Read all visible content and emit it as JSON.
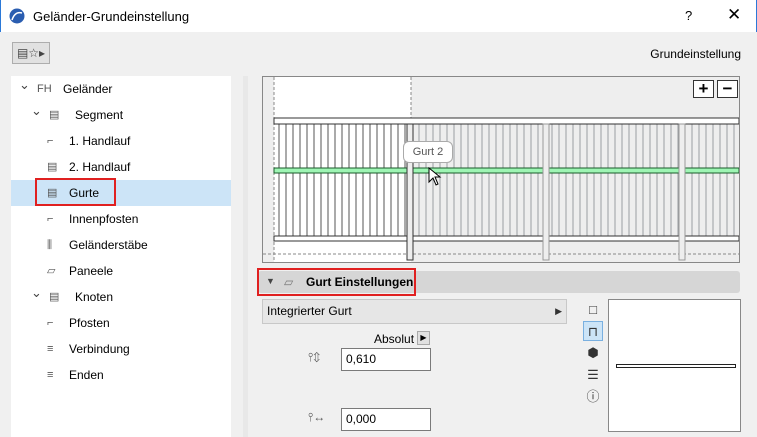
{
  "window": {
    "title": "Geländer-Grundeinstellung",
    "help": "?",
    "close": "✕"
  },
  "toolbar": {
    "favorites_icon": "railing-star-icon",
    "mode_label": "Grundeinstellung"
  },
  "tree": [
    {
      "label": "Geländer",
      "level": 0,
      "expanded": true
    },
    {
      "label": "Segment",
      "level": 1,
      "expanded": true
    },
    {
      "label": "1. Handlauf",
      "level": 2
    },
    {
      "label": "2. Handlauf",
      "level": 2
    },
    {
      "label": "Gurte",
      "level": 2,
      "selected": true
    },
    {
      "label": "Innenpfosten",
      "level": 2
    },
    {
      "label": "Geländerstäbe",
      "level": 2
    },
    {
      "label": "Paneele",
      "level": 2
    },
    {
      "label": "Knoten",
      "level": 1,
      "expanded": true
    },
    {
      "label": "Pfosten",
      "level": 2
    },
    {
      "label": "Verbindung",
      "level": 2
    },
    {
      "label": "Enden",
      "level": 2
    }
  ],
  "preview": {
    "tooltip": "Gurt 2",
    "zoom_in": "+",
    "zoom_out": "−",
    "highlight_color": "#9ef5b4"
  },
  "section": {
    "title": "Gurt Einstellungen",
    "dropdown": "Integrierter Gurt",
    "mode": "Absolut",
    "height_value": "0,610",
    "offset_value": "0,000"
  },
  "accent": "#e02020"
}
